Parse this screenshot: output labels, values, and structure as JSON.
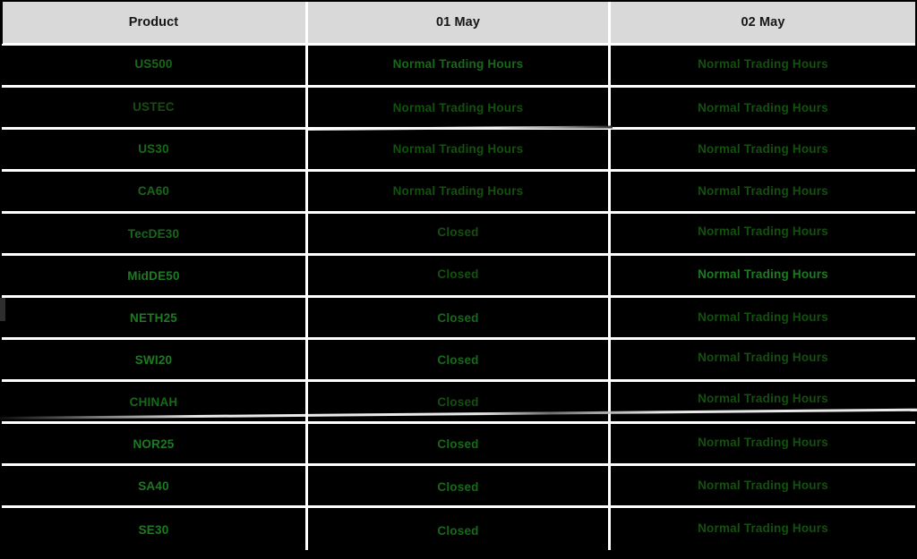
{
  "table": {
    "columns": [
      {
        "key": "product",
        "label": "Product"
      },
      {
        "key": "day1",
        "label": "01 May"
      },
      {
        "key": "day2",
        "label": "02 May"
      }
    ],
    "status_labels": {
      "open": "Normal Trading Hours",
      "closed": "Closed"
    },
    "colors": {
      "header_background": "#d9d9d9",
      "header_text": "#161616",
      "cell_background": "#000000",
      "grid_line": "#ffffff",
      "status_open_text": "#17691a",
      "status_closed_text": "#17691a"
    },
    "rows": [
      {
        "product": "US500",
        "day1": "Normal Trading Hours",
        "day2": "Normal Trading Hours"
      },
      {
        "product": "USTEC",
        "day1": "Normal Trading Hours",
        "day2": "Normal Trading Hours"
      },
      {
        "product": "US30",
        "day1": "Normal Trading Hours",
        "day2": "Normal Trading Hours"
      },
      {
        "product": "CA60",
        "day1": "Normal Trading Hours",
        "day2": "Normal Trading Hours"
      },
      {
        "product": "TecDE30",
        "day1": "Closed",
        "day2": "Normal Trading Hours"
      },
      {
        "product": "MidDE50",
        "day1": "Closed",
        "day2": "Normal Trading Hours"
      },
      {
        "product": "NETH25",
        "day1": "Closed",
        "day2": "Normal Trading Hours"
      },
      {
        "product": "SWI20",
        "day1": "Closed",
        "day2": "Normal Trading Hours"
      },
      {
        "product": "CHINAH",
        "day1": "Closed",
        "day2": "Normal Trading Hours"
      },
      {
        "product": "NOR25",
        "day1": "Closed",
        "day2": "Normal Trading Hours"
      },
      {
        "product": "SA40",
        "day1": "Closed",
        "day2": "Normal Trading Hours"
      },
      {
        "product": "SE30",
        "day1": "Closed",
        "day2": "Normal Trading Hours"
      }
    ]
  }
}
